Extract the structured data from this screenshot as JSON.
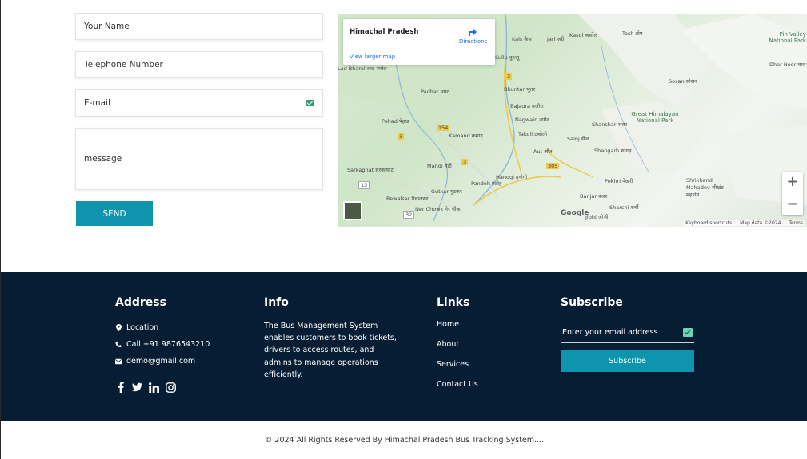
{
  "form": {
    "name_placeholder": "Your Name",
    "tel_placeholder": "Telephone Number",
    "email_placeholder": "E-mail",
    "message_placeholder": "message",
    "send_label": "SEND"
  },
  "map": {
    "place_name": "Himachal Pradesh",
    "directions_label": "Directions",
    "larger_map_label": "View larger map",
    "zoom_in": "+",
    "zoom_out": "−",
    "google_label": "Google",
    "keyboard_shortcuts": "Keyboard shortcuts",
    "map_data": "Map data ©2024",
    "terms": "Terms",
    "labels": [
      {
        "text": "Kais कैस"
      },
      {
        "text": "Jari जरी"
      },
      {
        "text": "Kasol कसोल"
      },
      {
        "text": "Tosh तोष"
      },
      {
        "text": "Pin Valley National Park"
      },
      {
        "text": "Kullu कुल्लू"
      },
      {
        "text": "Dhar Noor धार नूर"
      },
      {
        "text": "Sosan सोसन"
      },
      {
        "text": "Padhar पधर"
      },
      {
        "text": "Bhuntar भुंतर"
      },
      {
        "text": "Bajaura बजौरा"
      },
      {
        "text": "Nagwain नागैन"
      },
      {
        "text": "Great Himalayan National Park"
      },
      {
        "text": "Pehad पेहाड"
      },
      {
        "text": "Takoli टकोली"
      },
      {
        "text": "Shanshar शंशर"
      },
      {
        "text": "Kamand कमांद"
      },
      {
        "text": "Sainj सैंज"
      },
      {
        "text": "Shangarh शांगढ़"
      },
      {
        "text": "Aut औत"
      },
      {
        "text": "Mandi मंडी"
      },
      {
        "text": "Sarkaghat सरकाघाट"
      },
      {
        "text": "Hanogi हनोगी"
      },
      {
        "text": "Pandoh पंडोह"
      },
      {
        "text": "Pekhri पेखरी"
      },
      {
        "text": "Shrikhand Mahadev श्रीखंड महादेव"
      },
      {
        "text": "Gutkar गुटकर"
      },
      {
        "text": "Banjar बंजर"
      },
      {
        "text": "Rewalsar रिवालसर"
      },
      {
        "text": "Sharchi शर्ची"
      },
      {
        "text": "Ner Chowk नेर चौक"
      },
      {
        "text": "Jibhi जीभी"
      },
      {
        "text": "Lad Bharol लाड भरोल"
      }
    ],
    "road_badges": [
      "154",
      "3",
      "3",
      "305",
      "3",
      "13",
      "32"
    ]
  },
  "footer": {
    "address_title": "Address",
    "location": "Location",
    "phone": "Call +91 9876543210",
    "email": "demo@gmail.com",
    "info_title": "Info",
    "info_text": "The Bus Management System enables customers to book tickets, drivers to access routes, and admins to manage operations efficiently.",
    "links_title": "Links",
    "links": [
      "Home",
      "About",
      "Services",
      "Contact Us"
    ],
    "subscribe_title": "Subscribe",
    "subscribe_placeholder": "Enter your email address",
    "subscribe_button": "Subscribe",
    "social_icons": [
      "facebook-icon",
      "twitter-icon",
      "linkedin-icon",
      "instagram-icon"
    ]
  },
  "copyright": "© 2024 All Rights Reserved By Himachal Pradesh Bus Tracking System...."
}
